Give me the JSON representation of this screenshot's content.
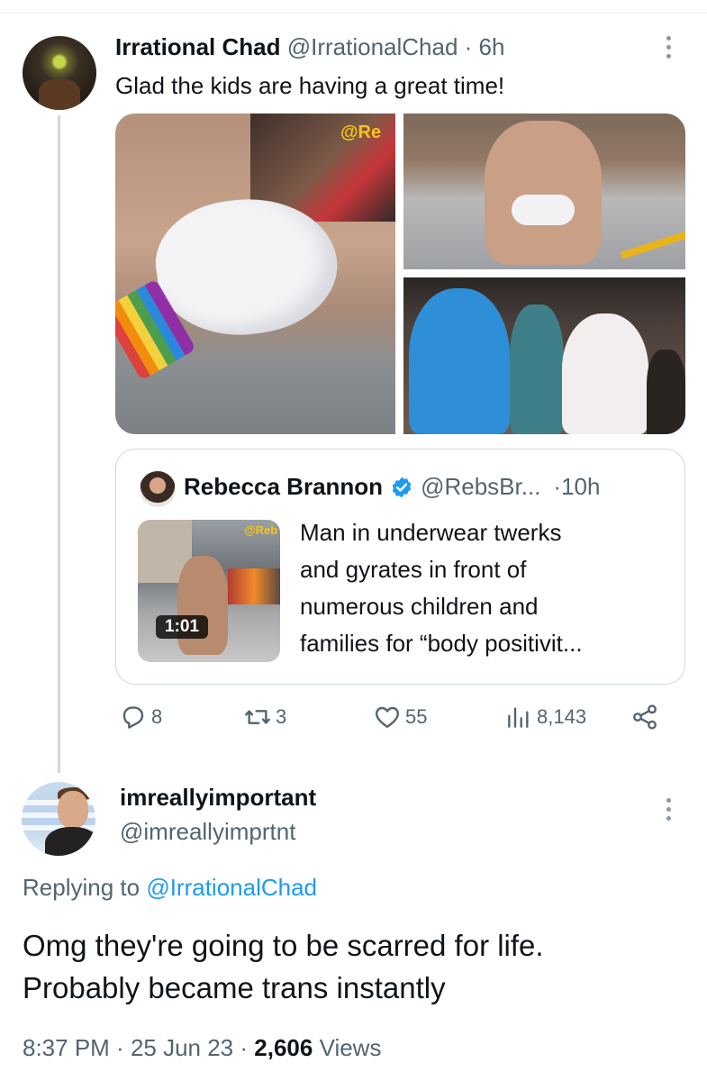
{
  "tweet": {
    "author_name": "Irrational Chad",
    "author_handle": "@IrrationalChad",
    "separator": " · ",
    "time": "6h",
    "text": "Glad the kids are having a great time!",
    "media_watermark": "@Re",
    "quote": {
      "author_name": "Rebecca Brannon",
      "author_handle": "@RebsBr...",
      "time_prefix": "·",
      "time": "10h",
      "thumb_watermark": "@Reb",
      "video_duration": "1:01",
      "text_lines": [
        "Man in underwear twerks",
        "and gyrates in front of",
        "numerous children and",
        "families  for “body positivit..."
      ],
      "verified_color": "#1d9bf0"
    },
    "actions": {
      "replies": "8",
      "retweets": "3",
      "likes": "55",
      "views": "8,143"
    }
  },
  "reply": {
    "author_name": "imreallyimportant",
    "author_handle": "@imreallyimprtnt",
    "replying_prefix": "Replying to ",
    "replying_to": "@IrrationalChad",
    "text_lines": [
      "Omg they're going to be scarred for life.",
      "Probably became trans instantly"
    ],
    "time": "8:37 PM",
    "date": "25 Jun 23",
    "views_count": "2,606",
    "views_label": "Views"
  },
  "colors": {
    "text": "#0f1419",
    "secondary": "#536471",
    "link": "#1d9bf0",
    "border": "#cfd9de"
  },
  "icons": [
    "more-icon",
    "verified-badge-icon",
    "reply-icon",
    "retweet-icon",
    "like-icon",
    "views-icon",
    "share-icon"
  ]
}
